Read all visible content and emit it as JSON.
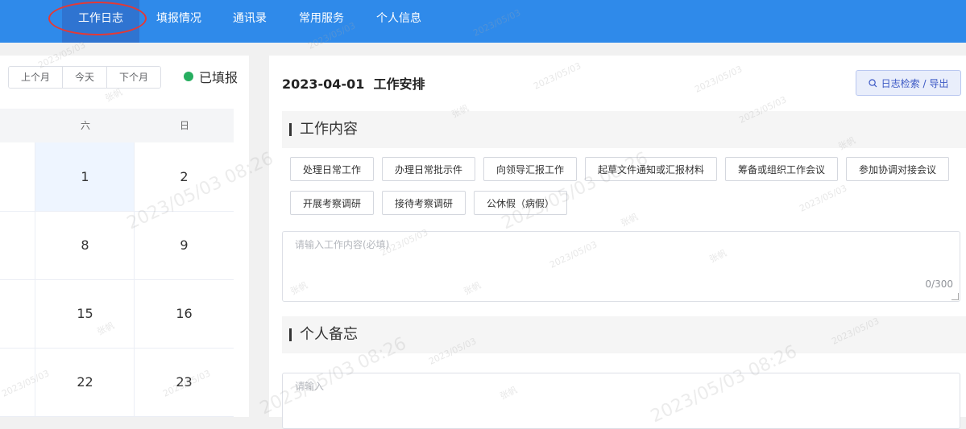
{
  "nav": {
    "items": [
      {
        "label": "工作日志",
        "active": true
      },
      {
        "label": "填报情况",
        "active": false
      },
      {
        "label": "通讯录",
        "active": false
      },
      {
        "label": "常用服务",
        "active": false
      },
      {
        "label": "个人信息",
        "active": false
      }
    ]
  },
  "calendar": {
    "buttons": [
      "上个月",
      "今天",
      "下个月"
    ],
    "status_label": "已填报",
    "status_color": "#27ae60",
    "weekdays": [
      "六",
      "日"
    ],
    "rows": [
      [
        "1",
        "2"
      ],
      [
        "8",
        "9"
      ],
      [
        "15",
        "16"
      ],
      [
        "22",
        "23"
      ]
    ],
    "today": "1"
  },
  "main": {
    "title": "2023-04-01  工作安排",
    "search_button": "日志检索 / 导出",
    "work_section": {
      "title": "工作内容",
      "tags": [
        "处理日常工作",
        "办理日常批示件",
        "向领导汇报工作",
        "起草文件通知或汇报材料",
        "筹备或组织工作会议",
        "参加协调对接会议",
        "开展考察调研",
        "接待考察调研",
        "公休假（病假）"
      ],
      "placeholder": "请输入工作内容(必填)",
      "counter": "0/300"
    },
    "memo_section": {
      "title": "个人备忘",
      "placeholder": "请输入"
    }
  },
  "watermark": {
    "name": "张帆",
    "date": "2023/05/03",
    "datetime": "2023/05/03 08:26"
  },
  "colors": {
    "nav_bg": "#2f8aea",
    "nav_active_bg": "#2f74d1",
    "highlight_ring": "#e53935",
    "accent": "#3a57c4"
  }
}
